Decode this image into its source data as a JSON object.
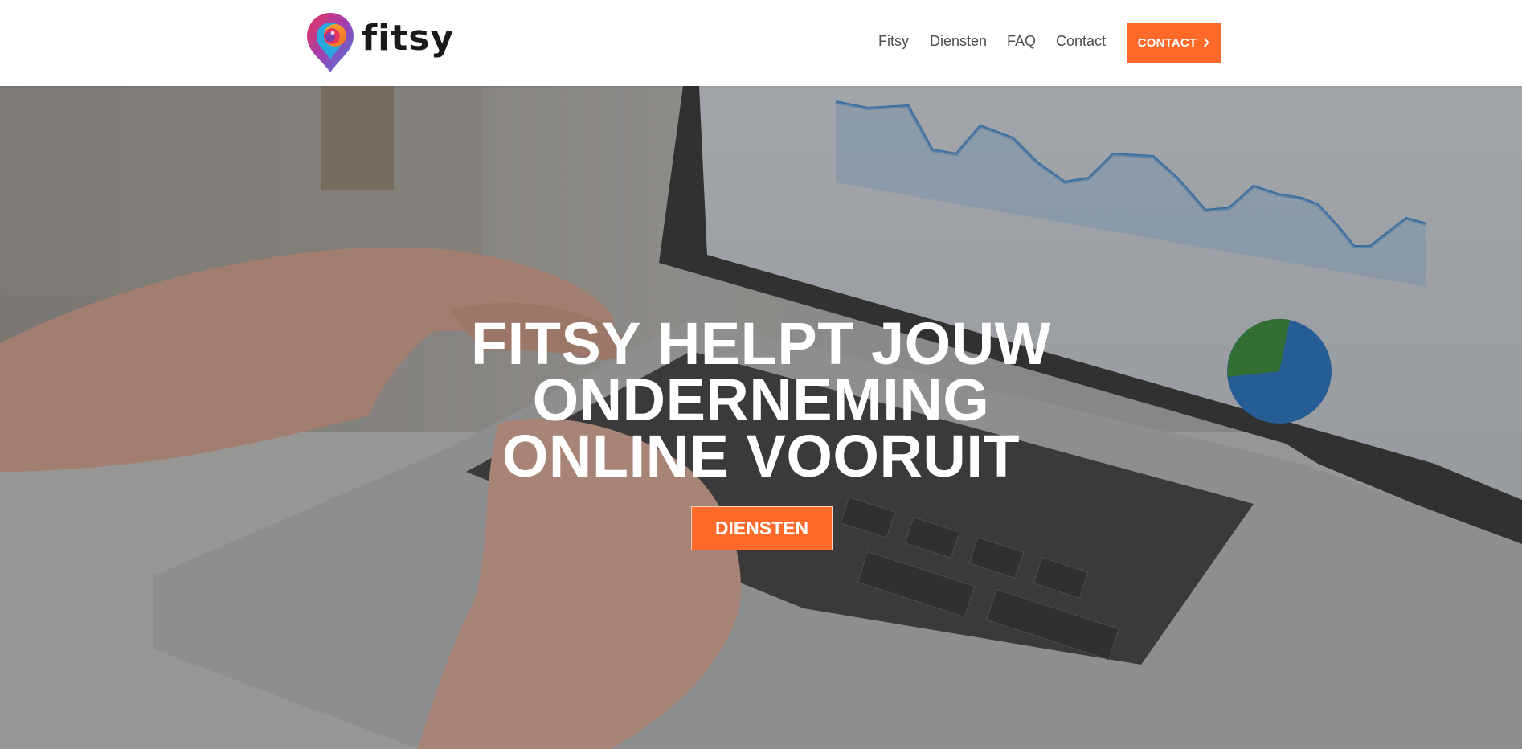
{
  "brand": {
    "name": "fitsy",
    "accent_color": "#ff6a2b",
    "logo_icon": "map-pin-logo-icon"
  },
  "nav": {
    "items": [
      {
        "label": "Fitsy"
      },
      {
        "label": "Diensten"
      },
      {
        "label": "FAQ"
      },
      {
        "label": "Contact"
      }
    ],
    "cta_label": "CONTACT",
    "cta_icon": "chevron-right-icon"
  },
  "hero": {
    "title": "FITSY HELPT JOUW ONDERNEMING ONLINE VOORUIT",
    "button_label": "DIENSTEN",
    "background": "laptop-analytics-photo"
  }
}
